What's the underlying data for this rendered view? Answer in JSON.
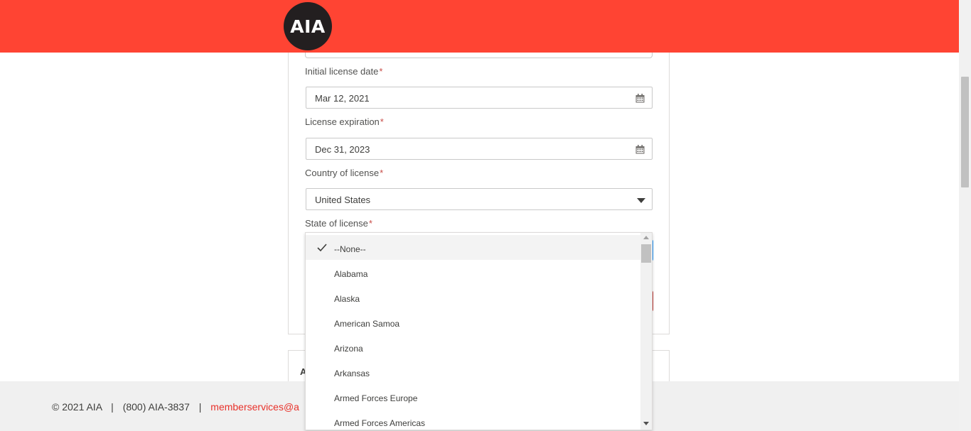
{
  "header": {
    "logo_text": "AIA",
    "brand_color": "#ff4433"
  },
  "form": {
    "initial_license_date": {
      "label": "Initial license date",
      "required_mark": "*",
      "value": "Mar 12, 2021",
      "icon": "calendar-icon"
    },
    "license_expiration": {
      "label": "License expiration",
      "required_mark": "*",
      "value": "Dec 31, 2023",
      "icon": "calendar-icon"
    },
    "country_of_license": {
      "label": "Country of license",
      "required_mark": "*",
      "value": "United States",
      "icon": "chevron-down-icon"
    },
    "state_of_license": {
      "label": "State of license",
      "required_mark": "*"
    }
  },
  "dropdown": {
    "selected_index": 0,
    "options": [
      "--None--",
      "Alabama",
      "Alaska",
      "American Samoa",
      "Arizona",
      "Arkansas",
      "Armed Forces Europe",
      "Armed Forces Americas"
    ]
  },
  "card2": {
    "title_fragment": "A"
  },
  "footer": {
    "copyright": "© 2021 AIA",
    "separator": "|",
    "phone": "(800) AIA-3837",
    "email_fragment": "memberservices@a"
  }
}
